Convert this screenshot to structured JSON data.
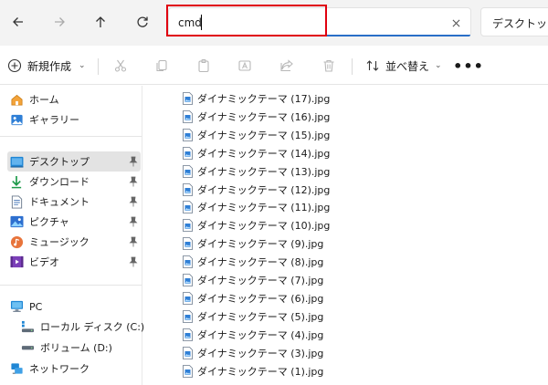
{
  "nav": {
    "back_icon": "arrow-left-icon",
    "forward_icon": "arrow-right-icon",
    "up_icon": "arrow-up-icon",
    "refresh_icon": "refresh-icon",
    "address_value": "cmd",
    "clear_icon": "close-icon",
    "search_text": "デスクトップの"
  },
  "toolbar": {
    "new_label": "新規作成",
    "sort_label": "並べ替え",
    "more_label": "•••",
    "icons": [
      "cut-icon",
      "copy-icon",
      "paste-icon",
      "rename-icon",
      "share-icon",
      "delete-icon"
    ]
  },
  "sidebar": {
    "items": [
      {
        "label": "ホーム",
        "icon": "home-icon"
      },
      {
        "label": "ギャラリー",
        "icon": "gallery-icon"
      },
      {
        "label": "デスクトップ",
        "icon": "desktop-icon",
        "pinned": true,
        "selected": true
      },
      {
        "label": "ダウンロード",
        "icon": "download-icon",
        "pinned": true
      },
      {
        "label": "ドキュメント",
        "icon": "documents-icon",
        "pinned": true
      },
      {
        "label": "ピクチャ",
        "icon": "pictures-icon",
        "pinned": true
      },
      {
        "label": "ミュージック",
        "icon": "music-icon",
        "pinned": true
      },
      {
        "label": "ビデオ",
        "icon": "videos-icon",
        "pinned": true
      },
      {
        "label": "PC",
        "icon": "pc-icon"
      },
      {
        "label": "ローカル ディスク (C:)",
        "icon": "local-disk-icon"
      },
      {
        "label": "ボリューム (D:)",
        "icon": "drive-icon"
      },
      {
        "label": "ネットワーク",
        "icon": "network-icon"
      }
    ]
  },
  "files": [
    "ダイナミックテーマ (17).jpg",
    "ダイナミックテーマ (16).jpg",
    "ダイナミックテーマ (15).jpg",
    "ダイナミックテーマ (14).jpg",
    "ダイナミックテーマ (13).jpg",
    "ダイナミックテーマ (12).jpg",
    "ダイナミックテーマ (11).jpg",
    "ダイナミックテーマ (10).jpg",
    "ダイナミックテーマ (9).jpg",
    "ダイナミックテーマ (8).jpg",
    "ダイナミックテーマ (7).jpg",
    "ダイナミックテーマ (6).jpg",
    "ダイナミックテーマ (5).jpg",
    "ダイナミックテーマ (4).jpg",
    "ダイナミックテーマ (3).jpg",
    "ダイナミックテーマ (1).jpg"
  ],
  "colors": {
    "highlight": "#e0000f",
    "accent": "#2a6fc7",
    "selection": "#e3e3e3"
  }
}
